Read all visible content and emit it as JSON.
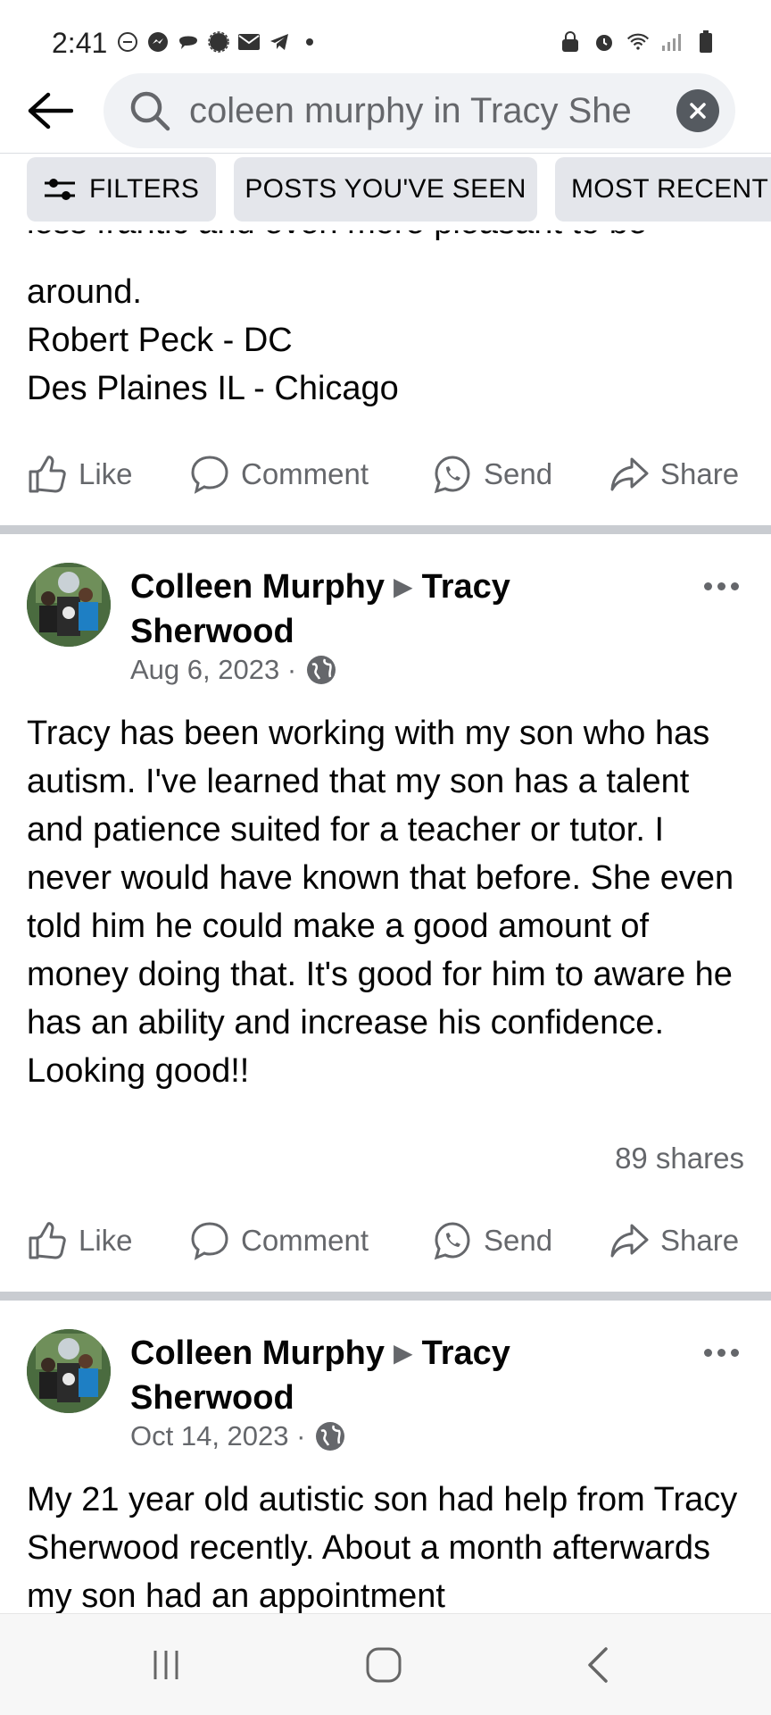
{
  "status": {
    "time": "2:41"
  },
  "search": {
    "query": "coleen murphy in Tracy She"
  },
  "chips": {
    "filters": "FILTERS",
    "seen": "POSTS YOU'VE SEEN",
    "recent": "MOST RECENT"
  },
  "top_post": {
    "cut_text": "less frantic and even more pleasant to be",
    "lines": [
      "around.",
      "Robert Peck - DC",
      "Des Plaines IL - Chicago"
    ]
  },
  "actions": {
    "like": "Like",
    "comment": "Comment",
    "send": "Send",
    "share": "Share"
  },
  "posts": [
    {
      "author": "Colleen Murphy",
      "target_first": "Tracy",
      "target_second": "Sherwood",
      "date": "Aug 6, 2023 ·",
      "text": "Tracy has been working with my son who has autism. I've learned that my son has a talent and patience suited for a teacher or tutor.  I never would have known that before. She even told him he could make a good amount of money doing that.  It's good for him to aware he has an ability and increase his confidence.  Looking good!!",
      "shares": "89 shares"
    },
    {
      "author": "Colleen Murphy",
      "target_first": "Tracy",
      "target_second": "Sherwood",
      "date": "Oct 14, 2023 ·",
      "text": "My 21 year old autistic son had help from Tracy Sherwood recently.  About a month afterwards my son had an appointment"
    }
  ],
  "colors": {
    "secondary_text": "#65676b",
    "divider": "#c9ccd1",
    "chip_bg": "#e4e6eb"
  }
}
